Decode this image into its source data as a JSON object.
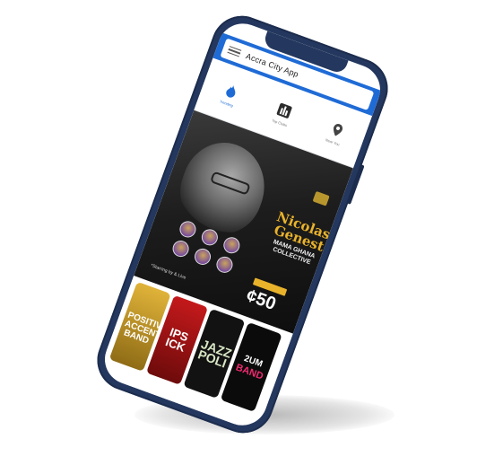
{
  "app": {
    "title": "Accra City App"
  },
  "tabs": [
    {
      "label": "Trending",
      "icon": "flame-icon",
      "active": true
    },
    {
      "label": "Top Clubs",
      "icon": "city-icon",
      "active": false
    },
    {
      "label": "Near You",
      "icon": "map-pin-icon",
      "active": false
    }
  ],
  "poster": {
    "headline_line1": "Nicolas",
    "headline_line2": "Genest",
    "subline": "MAMA GHANA COLLECTIVE",
    "price": "¢50",
    "caption": "*Starring by & Live",
    "accent_color": "#e8b22b"
  },
  "thumbnails": [
    {
      "text": "POSITIVE ACCENT BAND",
      "color": "#e0b339"
    },
    {
      "text": "IPS ICK",
      "color": "#c4191b"
    },
    {
      "text": "JAZZ POLI",
      "color": "#121212"
    },
    {
      "text": "2UM",
      "text2": "BAND",
      "color": "#0b0b0b"
    }
  ],
  "theme": {
    "primary": "#1f6bd6",
    "frame": "#24375e"
  }
}
